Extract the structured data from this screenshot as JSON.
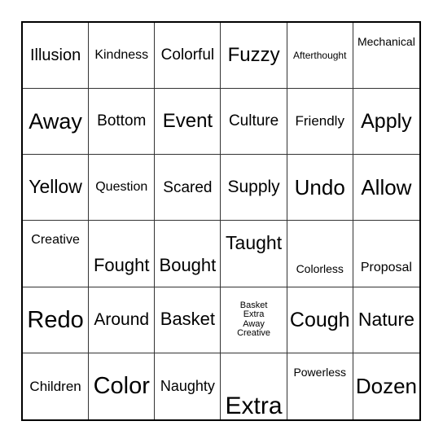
{
  "card": {
    "type": "bingo-card",
    "rows": 6,
    "columns": 6,
    "border_color": "#000000",
    "grid_line_color": "#333333",
    "background_color": "#ffffff",
    "text_color": "#000000",
    "cells": [
      [
        {
          "text": "Illusion",
          "size": 20,
          "align": "center"
        },
        {
          "text": "Kindness",
          "size": 16,
          "align": "center"
        },
        {
          "text": "Colorful",
          "size": 19,
          "align": "center"
        },
        {
          "text": "Fuzzy",
          "size": 24,
          "align": "center"
        },
        {
          "text": "Afterthought",
          "size": 12,
          "align": "center"
        },
        {
          "text": "Mechanical",
          "size": 14,
          "align": "upper"
        }
      ],
      [
        {
          "text": "Away",
          "size": 27,
          "align": "center"
        },
        {
          "text": "Bottom",
          "size": 19,
          "align": "center"
        },
        {
          "text": "Event",
          "size": 24,
          "align": "center"
        },
        {
          "text": "Culture",
          "size": 19,
          "align": "center"
        },
        {
          "text": "Friendly",
          "size": 17,
          "align": "center"
        },
        {
          "text": "Apply",
          "size": 25,
          "align": "center"
        }
      ],
      [
        {
          "text": "Yellow",
          "size": 23,
          "align": "center"
        },
        {
          "text": "Question",
          "size": 16,
          "align": "center"
        },
        {
          "text": "Scared",
          "size": 19,
          "align": "center"
        },
        {
          "text": "Supply",
          "size": 21,
          "align": "center"
        },
        {
          "text": "Undo",
          "size": 26,
          "align": "center"
        },
        {
          "text": "Allow",
          "size": 26,
          "align": "center"
        }
      ],
      [
        {
          "text": "Creative",
          "size": 16,
          "align": "upper"
        },
        {
          "text": "Fought",
          "size": 22,
          "align": "lower"
        },
        {
          "text": "Bought",
          "size": 22,
          "align": "lower"
        },
        {
          "text": "Taught",
          "size": 23,
          "align": "upper"
        },
        {
          "text": "Colorless",
          "size": 14,
          "align": "lower"
        },
        {
          "text": "Proposal",
          "size": 16,
          "align": "lower"
        }
      ],
      [
        {
          "text": "Redo",
          "size": 29,
          "align": "center"
        },
        {
          "text": "Around",
          "size": 21,
          "align": "center"
        },
        {
          "text": "Basket",
          "size": 22,
          "align": "center"
        },
        {
          "text": "Basket\nExtra\nAway\nCreative",
          "size": 11,
          "align": "center"
        },
        {
          "text": "Cough",
          "size": 25,
          "align": "center"
        },
        {
          "text": "Nature",
          "size": 23,
          "align": "center"
        }
      ],
      [
        {
          "text": "Children",
          "size": 17,
          "align": "center"
        },
        {
          "text": "Color",
          "size": 29,
          "align": "center"
        },
        {
          "text": "Naughty",
          "size": 18,
          "align": "center"
        },
        {
          "text": "Extra",
          "size": 30,
          "align": "bottom"
        },
        {
          "text": "Powerless",
          "size": 14,
          "align": "upper"
        },
        {
          "text": "Dozen",
          "size": 26,
          "align": "center"
        }
      ]
    ]
  }
}
